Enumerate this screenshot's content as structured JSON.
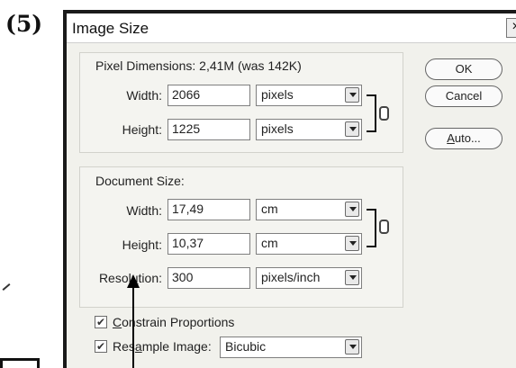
{
  "step_label": "(5)",
  "dialog": {
    "title": "Image Size",
    "close_glyph": "×"
  },
  "pixel_dimensions": {
    "title": "Pixel Dimensions:  2,41M (was 142K)",
    "width": {
      "label": "Width:",
      "value": "2066",
      "unit": "pixels"
    },
    "height": {
      "label": "Height:",
      "value": "1225",
      "unit": "pixels"
    }
  },
  "document_size": {
    "title": "Document Size:",
    "width": {
      "label": "Width:",
      "value": "17,49",
      "unit": "cm"
    },
    "height": {
      "label": "Height:",
      "value": "10,37",
      "unit": "cm"
    },
    "resolution": {
      "label_pre": "Resol",
      "label_u": "u",
      "label_post": "tion:",
      "value": "300",
      "unit": "pixels/inch"
    }
  },
  "options": {
    "constrain": {
      "checked": true,
      "label_pre": "",
      "label_u": "C",
      "label_post": "onstrain Proportions"
    },
    "resample": {
      "checked": true,
      "label_pre": "Res",
      "label_u": "a",
      "label_post": "mple Image:",
      "method": "Bicubic"
    },
    "check_glyph": "✔"
  },
  "buttons": {
    "ok": "OK",
    "cancel": "Cancel",
    "auto_u": "A",
    "auto_rest": "uto..."
  }
}
